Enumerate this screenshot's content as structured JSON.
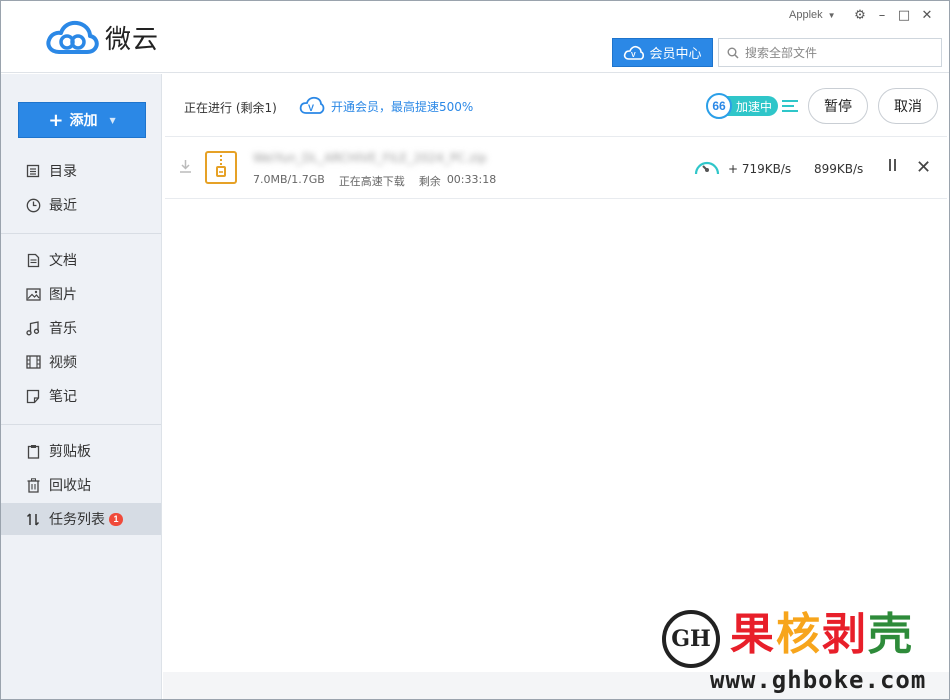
{
  "header": {
    "app_name": "微云",
    "user_name": "Applek",
    "window_controls": {
      "settings": "⚙",
      "minimize": "–",
      "maximize": "□",
      "close": "✕"
    },
    "vip_center_label": "会员中心",
    "search_placeholder": "搜索全部文件"
  },
  "sidebar": {
    "add_label": "添加",
    "groups": [
      [
        {
          "label": "目录",
          "icon": "catalog-icon"
        },
        {
          "label": "最近",
          "icon": "clock-icon"
        }
      ],
      [
        {
          "label": "文档",
          "icon": "document-icon"
        },
        {
          "label": "图片",
          "icon": "image-icon"
        },
        {
          "label": "音乐",
          "icon": "music-icon"
        },
        {
          "label": "视频",
          "icon": "video-icon"
        },
        {
          "label": "笔记",
          "icon": "note-icon"
        }
      ],
      [
        {
          "label": "剪贴板",
          "icon": "clipboard-icon"
        },
        {
          "label": "回收站",
          "icon": "trash-icon"
        },
        {
          "label": "任务列表",
          "icon": "transfer-icon",
          "badge": "1",
          "active": true
        }
      ]
    ]
  },
  "main": {
    "status_text": "正在进行 (剩余1)",
    "vip_promo": "开通会员，最高提速500%",
    "speedup_number": "66",
    "speedup_label": "加速中",
    "pause_all_label": "暂停",
    "cancel_all_label": "取消",
    "task": {
      "file_name": "WeiYun_DL_ARCHIVE_FILE_2024_PC.zip",
      "size_progress": "7.0MB/1.7GB",
      "status": "正在高速下载",
      "remaining_label": "剩余",
      "remaining_time": "00:33:18",
      "boost_speed": "+ 719KB/s",
      "speed": "899KB/s"
    }
  },
  "watermark": {
    "seal_text": "GH",
    "title_chars": [
      "果",
      "核",
      "剥",
      "壳"
    ],
    "url": "www.ghboke.com"
  },
  "colors": {
    "accent": "#2b88e6",
    "speedup": "#2fc6c9",
    "badge": "#f04a3a",
    "zip_icon": "#e6a126",
    "sidebar_bg": "#eef1f6"
  }
}
